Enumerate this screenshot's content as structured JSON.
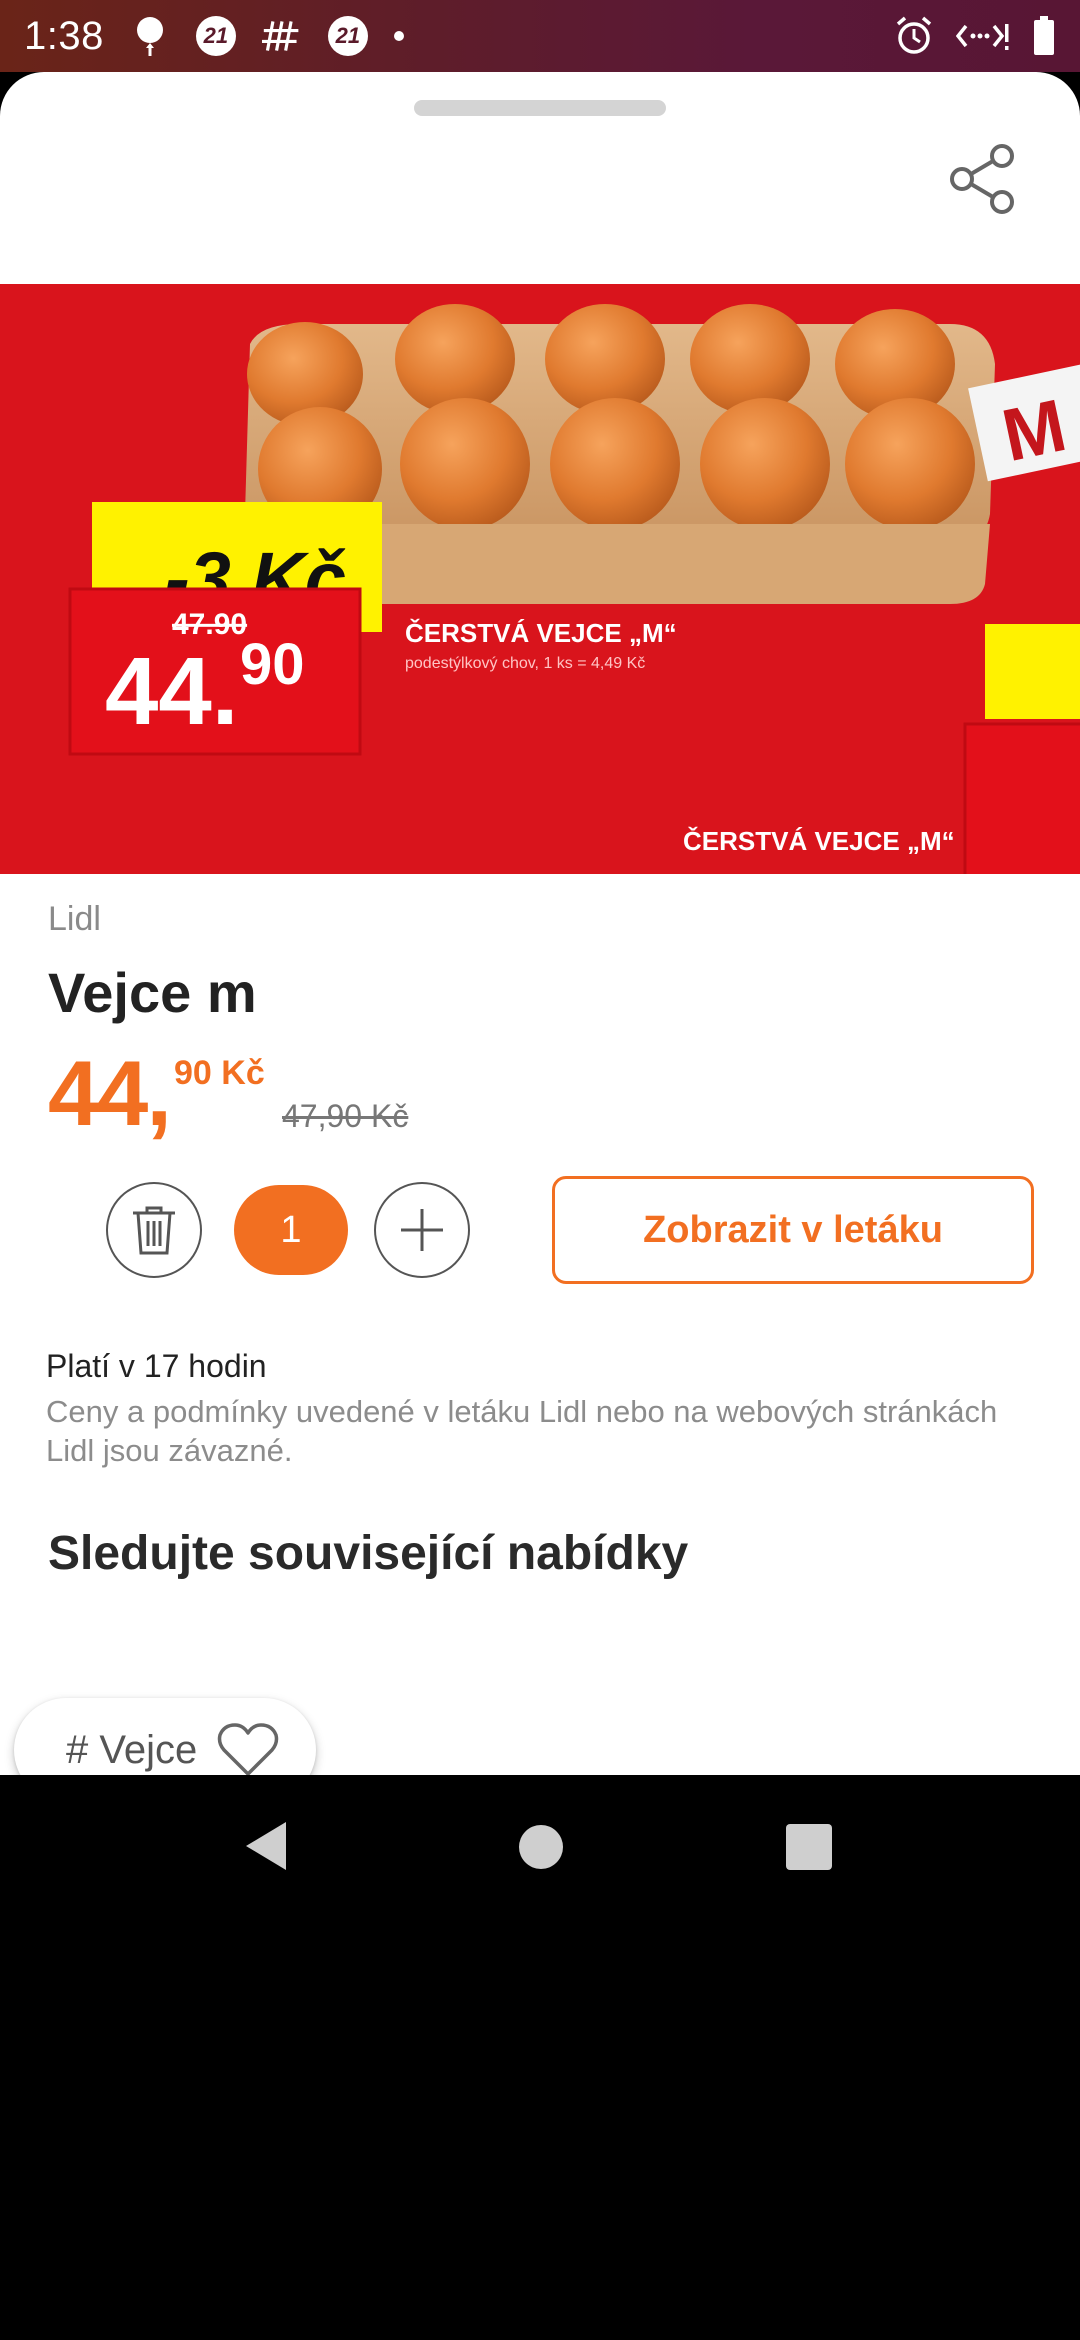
{
  "status_bar": {
    "time": "1:38",
    "badge_1": "21",
    "badge_2": "21",
    "icons": [
      "balloon-icon",
      "badge-21-icon",
      "hashtag-icon",
      "badge-21-icon",
      "dot-icon",
      "alarm-icon",
      "data-saver-icon",
      "battery-icon"
    ]
  },
  "product": {
    "store": "Lidl",
    "name": "Vejce m",
    "price_whole": "44,",
    "price_cents": "90 Kč",
    "price_old": "47,90 Kč",
    "quantity": "1",
    "show_in_flyer_label": "Zobrazit v letáku",
    "validity": "Platí v 17 hodin",
    "terms": "Ceny a podmínky uvedené v letáku Lidl nebo na webových stránkách Lidl jsou závazné."
  },
  "flyer_image": {
    "discount": "-3 Kč",
    "old_price": "47.90",
    "price_int": "44.",
    "price_dec": "90",
    "headline": "ČERSTVÁ VEJCE „M“",
    "subline": "podestýlkový chov, 1 ks = 4,49 Kč",
    "headline_2": "ČERSTVÁ VEJCE „M“",
    "accent_color": "#d9141c",
    "badge_color": "#fff200"
  },
  "related": {
    "title": "Sledujte související nabídky",
    "tag_label": "# Vejce"
  },
  "colors": {
    "accent": "#f26f21"
  }
}
